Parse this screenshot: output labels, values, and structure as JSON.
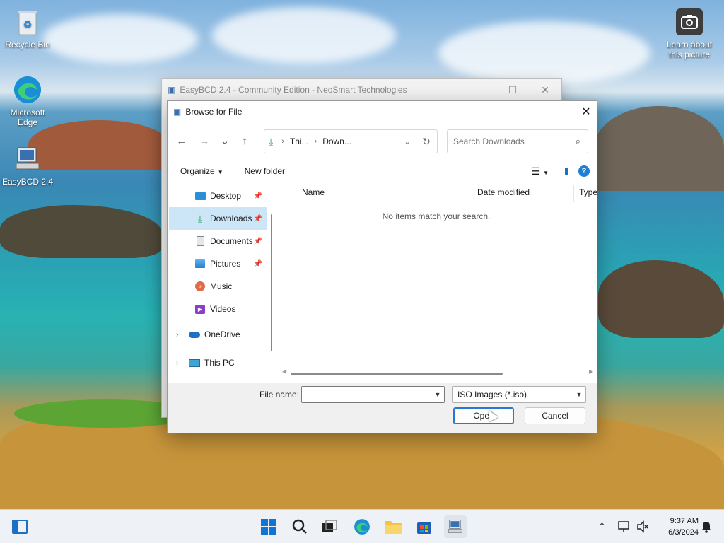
{
  "desktop": {
    "icons": [
      {
        "label": "Recycle Bin"
      },
      {
        "label": "Microsoft Edge"
      },
      {
        "label": "EasyBCD 2.4"
      },
      {
        "label": "Learn about this picture"
      }
    ]
  },
  "bg_window": {
    "title": "EasyBCD 2.4 - Community Edition - NeoSmart Technologies",
    "minimize": "—",
    "maximize": "☐",
    "close": "✕"
  },
  "dialog": {
    "title": "Browse for File",
    "close": "✕",
    "nav": {
      "back": "←",
      "forward": "→",
      "recent": "⌄",
      "up": "↑",
      "breadcrumb": [
        "Thi...",
        "Down..."
      ],
      "search_placeholder": "Search Downloads"
    },
    "commands": {
      "organize": "Organize",
      "new_folder": "New folder"
    },
    "nav_pane": {
      "items": [
        {
          "label": "Desktop",
          "pinned": true
        },
        {
          "label": "Downloads",
          "pinned": true,
          "selected": true
        },
        {
          "label": "Documents",
          "pinned": true
        },
        {
          "label": "Pictures",
          "pinned": true
        },
        {
          "label": "Music",
          "pinned": false
        },
        {
          "label": "Videos",
          "pinned": false
        }
      ],
      "roots": [
        {
          "label": "OneDrive"
        },
        {
          "label": "This PC"
        }
      ]
    },
    "columns": [
      "Name",
      "Date modified",
      "Type"
    ],
    "empty_message": "No items match your search.",
    "footer": {
      "file_name_label": "File name:",
      "file_name_value": "",
      "file_type": "ISO Images (*.iso)",
      "open": "Open",
      "cancel": "Cancel"
    }
  },
  "taskbar": {
    "time": "9:37 AM",
    "date": "6/3/2024"
  }
}
